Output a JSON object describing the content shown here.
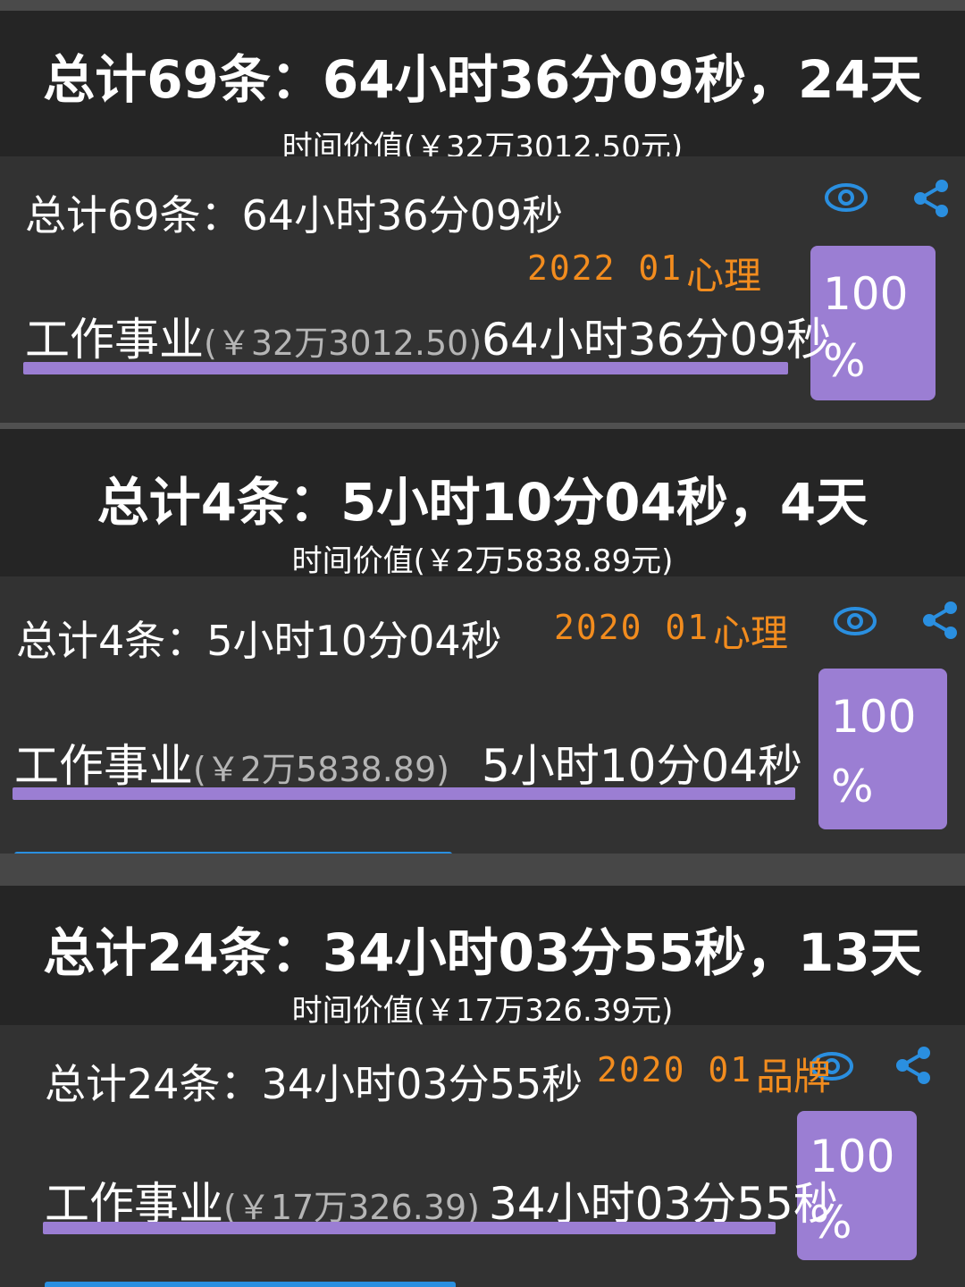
{
  "colors": {
    "accent_purple": "#9b7ed3",
    "accent_orange": "#f28c1e",
    "accent_blue": "#2a8fe0",
    "header_bg": "#252525",
    "card_bg": "#323232"
  },
  "sections": [
    {
      "header_title": "总计69条：64小时36分09秒，24天",
      "header_value": "时间价值(￥32万3012.50元)",
      "card": {
        "total": "总计69条：64小时36分09秒",
        "date": "2022 01",
        "category": "心理",
        "row_label": "工作事业",
        "row_value": "(￥32万3012.50)",
        "row_duration": "64小时36分09秒",
        "percent_num": "100",
        "percent_sym": "%",
        "view_icon": "eye-icon",
        "share_icon": "share-icon",
        "bar_fraction": 1.0
      }
    },
    {
      "header_title": "总计4条：5小时10分04秒，4天",
      "header_value": "时间价值(￥2万5838.89元)",
      "card": {
        "total": "总计4条：5小时10分04秒",
        "date": "2020 01",
        "category": "心理",
        "row_label": "工作事业",
        "row_value": "(￥2万5838.89)",
        "row_duration": "5小时10分04秒",
        "percent_num": "100",
        "percent_sym": "%",
        "view_icon": "eye-icon",
        "share_icon": "share-icon",
        "bar_fraction": 1.0
      }
    },
    {
      "header_title": "总计24条：34小时03分55秒，13天",
      "header_value": "时间价值(￥17万326.39元)",
      "card": {
        "total": "总计24条：34小时03分55秒",
        "date": "2020 01",
        "category": "品牌",
        "row_label": "工作事业",
        "row_value": "(￥17万326.39)",
        "row_duration": "34小时03分55秒",
        "percent_num": "100",
        "percent_sym": "%",
        "view_icon": "eye-icon",
        "share_icon": "share-icon",
        "bar_fraction": 1.0
      }
    }
  ]
}
